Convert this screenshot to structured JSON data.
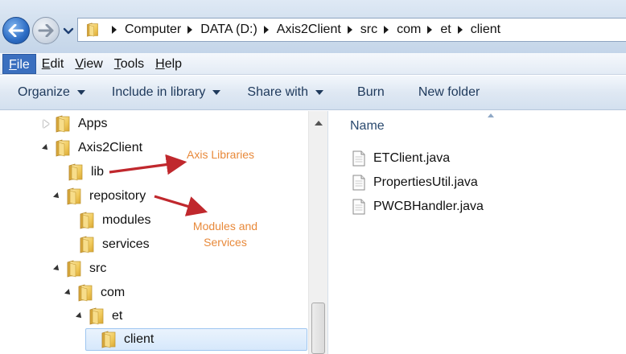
{
  "address_bar": {
    "crumbs": [
      "Computer",
      "DATA (D:)",
      "Axis2Client",
      "src",
      "com",
      "et",
      "client"
    ]
  },
  "menu": {
    "items": [
      {
        "pre": "",
        "accel": "F",
        "post": "ile"
      },
      {
        "pre": "",
        "accel": "E",
        "post": "dit"
      },
      {
        "pre": "",
        "accel": "V",
        "post": "iew"
      },
      {
        "pre": "",
        "accel": "T",
        "post": "ools"
      },
      {
        "pre": "",
        "accel": "H",
        "post": "elp"
      }
    ]
  },
  "toolbar": {
    "organize": "Organize",
    "include_in_library": "Include in library",
    "share_with": "Share with",
    "burn": "Burn",
    "new_folder": "New folder"
  },
  "tree": [
    {
      "label": "Apps"
    },
    {
      "label": "Axis2Client"
    },
    {
      "label": "lib"
    },
    {
      "label": "repository"
    },
    {
      "label": "modules"
    },
    {
      "label": "services"
    },
    {
      "label": "src"
    },
    {
      "label": "com"
    },
    {
      "label": "et"
    },
    {
      "label": "client"
    }
  ],
  "annotations": {
    "axis_libraries": "Axis Libraries",
    "modules_line1": "Modules and",
    "modules_line2": "Services",
    "text_color": "#e8893a",
    "arrow_color": "#c0282d"
  },
  "content": {
    "column_name": "Name",
    "files": [
      "ETClient.java",
      "PropertiesUtil.java",
      "PWCBHandler.java"
    ]
  },
  "icons": {
    "back": "back-arrow-icon",
    "forward": "forward-arrow-icon",
    "folder": "folder-icon",
    "file": "java-file-icon"
  }
}
